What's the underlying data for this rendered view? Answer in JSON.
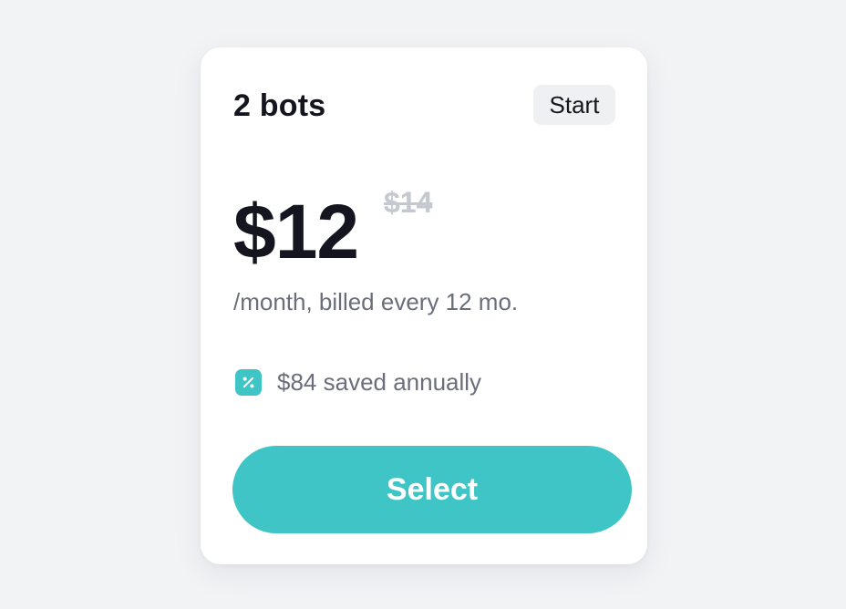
{
  "plan": {
    "name": "2 bots",
    "tier_badge": "Start",
    "price": "$12",
    "original_price": "$14",
    "billing_note": "/month, billed every 12 mo.",
    "savings": {
      "icon": "percent-icon",
      "text": "$84 saved annually"
    },
    "select_label": "Select"
  },
  "colors": {
    "accent": "#40c5c6",
    "background": "#f2f3f5",
    "card": "#ffffff",
    "primary_text": "#14151f",
    "secondary_text": "#6a6e7b",
    "strikethrough_text": "#c4c8cf",
    "badge_background": "#eff0f2"
  }
}
